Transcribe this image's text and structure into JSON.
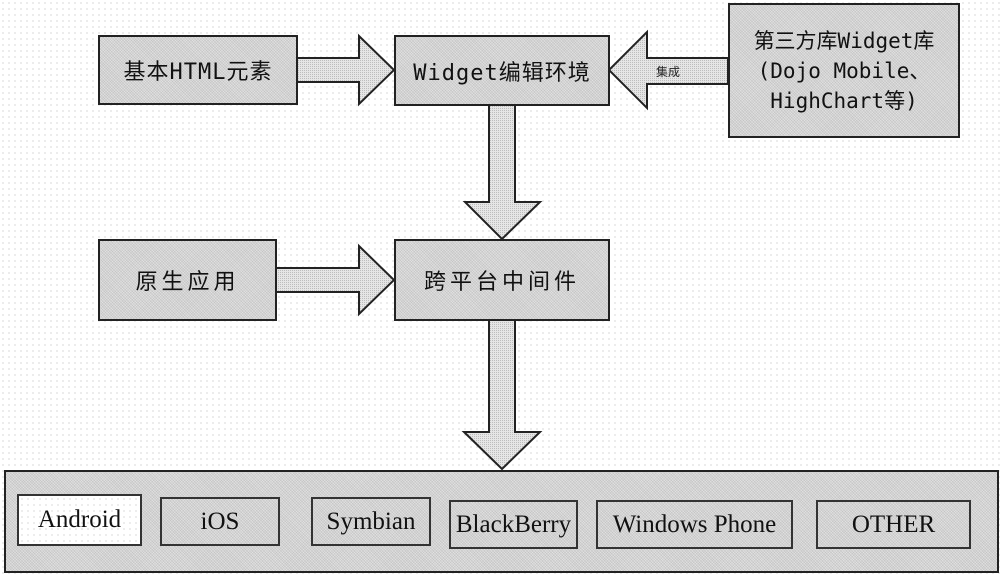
{
  "diagram": {
    "nodes": {
      "basic_html": {
        "label": "基本HTML元素"
      },
      "widget_env": {
        "label": "Widget编辑环境"
      },
      "third_party": {
        "lines": [
          "第三方库Widget库",
          "(Dojo Mobile、",
          "HighChart等)"
        ]
      },
      "native_app": {
        "label": "原生应用"
      },
      "middleware": {
        "label": "跨平台中间件"
      }
    },
    "edges": [
      {
        "from": "basic_html",
        "to": "widget_env",
        "label": ""
      },
      {
        "from": "third_party",
        "to": "widget_env",
        "label": "集成"
      },
      {
        "from": "widget_env",
        "to": "middleware",
        "label": ""
      },
      {
        "from": "native_app",
        "to": "middleware",
        "label": ""
      },
      {
        "from": "middleware",
        "to": "platforms",
        "label": ""
      }
    ],
    "platforms": [
      "Android",
      "iOS",
      "Symbian",
      "BlackBerry",
      "Windows Phone",
      "OTHER"
    ]
  }
}
